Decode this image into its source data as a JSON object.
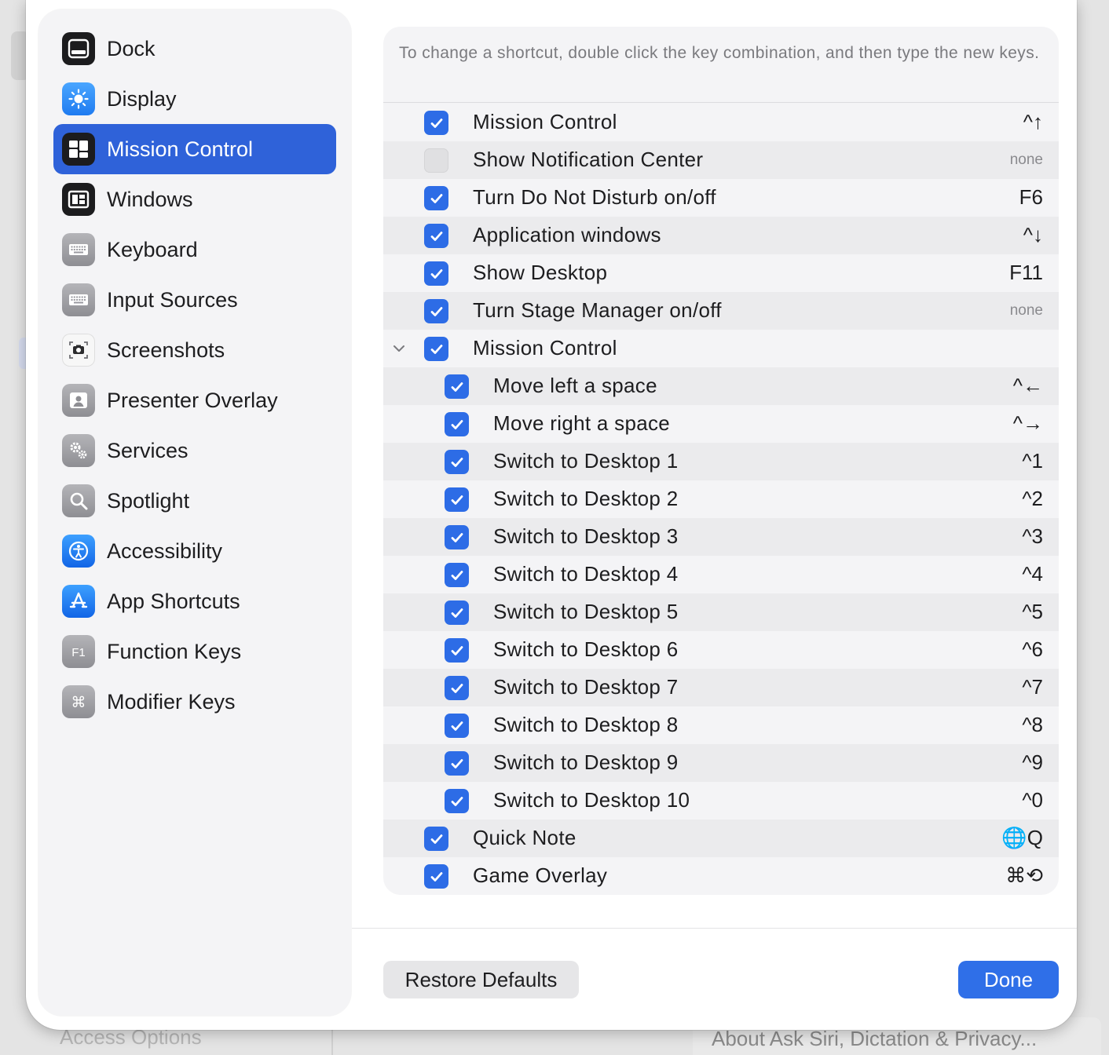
{
  "background": {
    "bottom_left_text": "Access Options",
    "bottom_right_text": "About Ask Siri, Dictation & Privacy..."
  },
  "sidebar": {
    "items": [
      {
        "label": "Dock",
        "icon": "dock-icon",
        "selected": false
      },
      {
        "label": "Display",
        "icon": "display-brightness-icon",
        "selected": false
      },
      {
        "label": "Mission Control",
        "icon": "mission-control-icon",
        "selected": true
      },
      {
        "label": "Windows",
        "icon": "windows-icon",
        "selected": false
      },
      {
        "label": "Keyboard",
        "icon": "keyboard-icon",
        "selected": false
      },
      {
        "label": "Input Sources",
        "icon": "input-sources-icon",
        "selected": false
      },
      {
        "label": "Screenshots",
        "icon": "screenshot-camera-icon",
        "selected": false
      },
      {
        "label": "Presenter Overlay",
        "icon": "presenter-overlay-icon",
        "selected": false
      },
      {
        "label": "Services",
        "icon": "services-gears-icon",
        "selected": false
      },
      {
        "label": "Spotlight",
        "icon": "spotlight-magnifier-icon",
        "selected": false
      },
      {
        "label": "Accessibility",
        "icon": "accessibility-icon",
        "selected": false
      },
      {
        "label": "App Shortcuts",
        "icon": "app-store-icon",
        "selected": false
      },
      {
        "label": "Function Keys",
        "icon": "function-key-icon",
        "selected": false
      },
      {
        "label": "Modifier Keys",
        "icon": "command-key-icon",
        "selected": false
      }
    ]
  },
  "main": {
    "intro": "To change a shortcut, double click the key combination, and then type the new keys.",
    "rows": [
      {
        "label": "Mission Control",
        "key": "^↑",
        "checked": true,
        "level": 0
      },
      {
        "label": "Show Notification Center",
        "key": "none",
        "checked": false,
        "level": 0
      },
      {
        "label": "Turn Do Not Disturb on/off",
        "key": "F6",
        "checked": true,
        "level": 0
      },
      {
        "label": "Application windows",
        "key": "^↓",
        "checked": true,
        "level": 0
      },
      {
        "label": "Show Desktop",
        "key": "F11",
        "checked": true,
        "level": 0
      },
      {
        "label": "Turn Stage Manager on/off",
        "key": "none",
        "checked": true,
        "level": 0
      },
      {
        "label": "Mission Control",
        "key": "",
        "checked": true,
        "level": 0,
        "expanded": true
      },
      {
        "label": "Move left a space",
        "key": "^←",
        "checked": true,
        "level": 1
      },
      {
        "label": "Move right a space",
        "key": "^→",
        "checked": true,
        "level": 1
      },
      {
        "label": "Switch to Desktop 1",
        "key": "^1",
        "checked": true,
        "level": 1
      },
      {
        "label": "Switch to Desktop 2",
        "key": "^2",
        "checked": true,
        "level": 1
      },
      {
        "label": "Switch to Desktop 3",
        "key": "^3",
        "checked": true,
        "level": 1
      },
      {
        "label": "Switch to Desktop 4",
        "key": "^4",
        "checked": true,
        "level": 1
      },
      {
        "label": "Switch to Desktop 5",
        "key": "^5",
        "checked": true,
        "level": 1
      },
      {
        "label": "Switch to Desktop 6",
        "key": "^6",
        "checked": true,
        "level": 1
      },
      {
        "label": "Switch to Desktop 7",
        "key": "^7",
        "checked": true,
        "level": 1
      },
      {
        "label": "Switch to Desktop 8",
        "key": "^8",
        "checked": true,
        "level": 1
      },
      {
        "label": "Switch to Desktop 9",
        "key": "^9",
        "checked": true,
        "level": 1
      },
      {
        "label": "Switch to Desktop 10",
        "key": "^0",
        "checked": true,
        "level": 1
      },
      {
        "label": "Quick Note",
        "key": "🌐Q",
        "checked": true,
        "level": 0
      },
      {
        "label": "Game Overlay",
        "key": "⌘⟲",
        "checked": true,
        "level": 0
      }
    ]
  },
  "footer": {
    "restore_label": "Restore Defaults",
    "done_label": "Done"
  },
  "colors": {
    "accent": "#2f62d9",
    "checkbox": "#2d6ce6",
    "done_button": "#2f6fe8"
  }
}
